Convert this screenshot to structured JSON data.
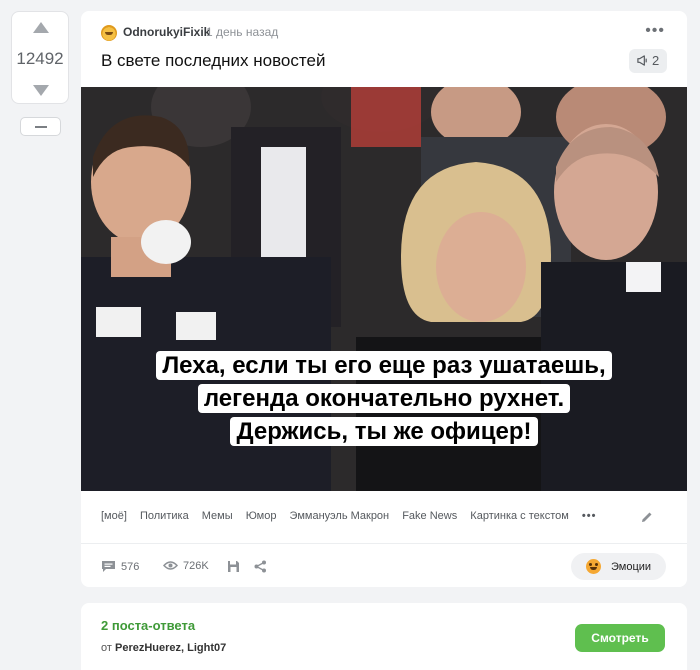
{
  "rating": {
    "score": "12492"
  },
  "story": {
    "author": "OdnorukyiFixik",
    "time": "1 день назад",
    "title": "В свете последних новостей",
    "comment_badge_count": "2",
    "caption": [
      "Леха, если ты его еще раз ушатаешь,",
      "легенда окончательно рухнет.",
      "Держись, ты же офицер!"
    ],
    "tags": [
      "[моё]",
      "Политика",
      "Мемы",
      "Юмор",
      "Эммануэль Макрон",
      "Fake News",
      "Картинка с текстом"
    ],
    "stats": {
      "comments": "576",
      "views": "726K"
    },
    "emotions_label": "Эмоции"
  },
  "answers": {
    "title": "2 поста-ответа",
    "from_prefix": "от",
    "from_users": "PerezHuerez, Light07",
    "button_label": "Смотреть"
  },
  "colors": {
    "accent_green": "#5fbf4f",
    "answers_green": "#3f9a38"
  }
}
